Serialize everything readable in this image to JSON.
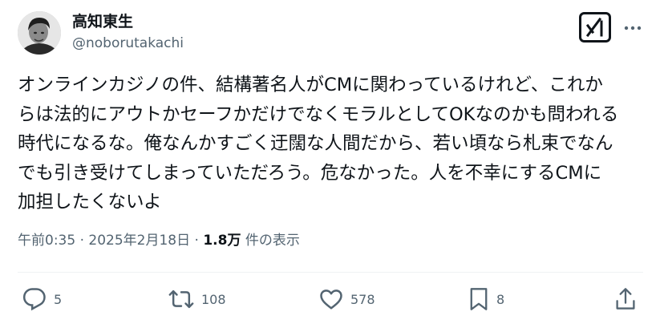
{
  "author": {
    "display_name": "高知東生",
    "handle": "@noborutakachi",
    "avatar_icon": "avatar-photo"
  },
  "header_icons": {
    "grok": "grok-icon",
    "more": "more-dots-icon"
  },
  "tweet": {
    "lines": [
      "オンラインカジノの件、結構著名人がCMに関わっているけれど、これか",
      "らは法的にアウトかセーフかだけでなくモラルとしてOKなのかも問われる",
      "時代になるな。俺なんかすごく迂闊な人間だから、若い頃なら札束でなん",
      "でも引き受けてしまっていただろう。危なかった。人を不幸にするCMに",
      "加担したくないよ"
    ]
  },
  "meta": {
    "time": "午前0:35",
    "separator1": " · ",
    "date": "2025年2月18日",
    "separator2": " · ",
    "views_count": "1.8万",
    "views_label": " 件の表示"
  },
  "actions": {
    "reply_count": "5",
    "repost_count": "108",
    "like_count": "578",
    "bookmark_count": "8"
  },
  "colors": {
    "text": "#0f1419",
    "secondary": "#536471",
    "divider": "#eff3f4"
  }
}
